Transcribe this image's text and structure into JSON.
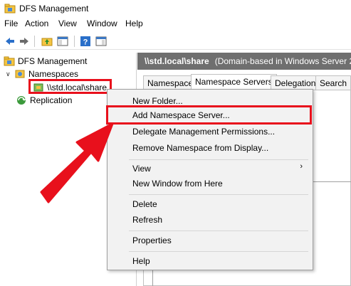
{
  "window": {
    "title": "DFS Management"
  },
  "menubar": {
    "items": [
      "File",
      "Action",
      "View",
      "Window",
      "Help"
    ]
  },
  "toolbar": {
    "buttons": [
      "back-arrow-icon",
      "forward-arrow-icon",
      "up-folder-icon",
      "show-hide-tree-icon",
      "help-icon",
      "properties-icon"
    ]
  },
  "tree": {
    "root": "DFS Management",
    "namespaces": "Namespaces",
    "share": "\\\\std.local\\share",
    "replication": "Replication"
  },
  "right_pane": {
    "header_path": "\\\\std.local\\share",
    "header_desc": "(Domain-based in Windows Server 2",
    "tabs": [
      "Namespace",
      "Namespace Servers",
      "Delegation",
      "Search"
    ]
  },
  "context_menu": {
    "items": [
      "New Folder...",
      "Add Namespace Server...",
      "Delegate Management Permissions...",
      "Remove Namespace from Display...",
      "View",
      "New Window from Here",
      "Delete",
      "Refresh",
      "Properties",
      "Help"
    ],
    "submenu_glyph": "›"
  },
  "colors": {
    "highlight": "#e8101c",
    "header_bg": "#6f6f6f",
    "menu_bg": "#f2f2f2"
  }
}
